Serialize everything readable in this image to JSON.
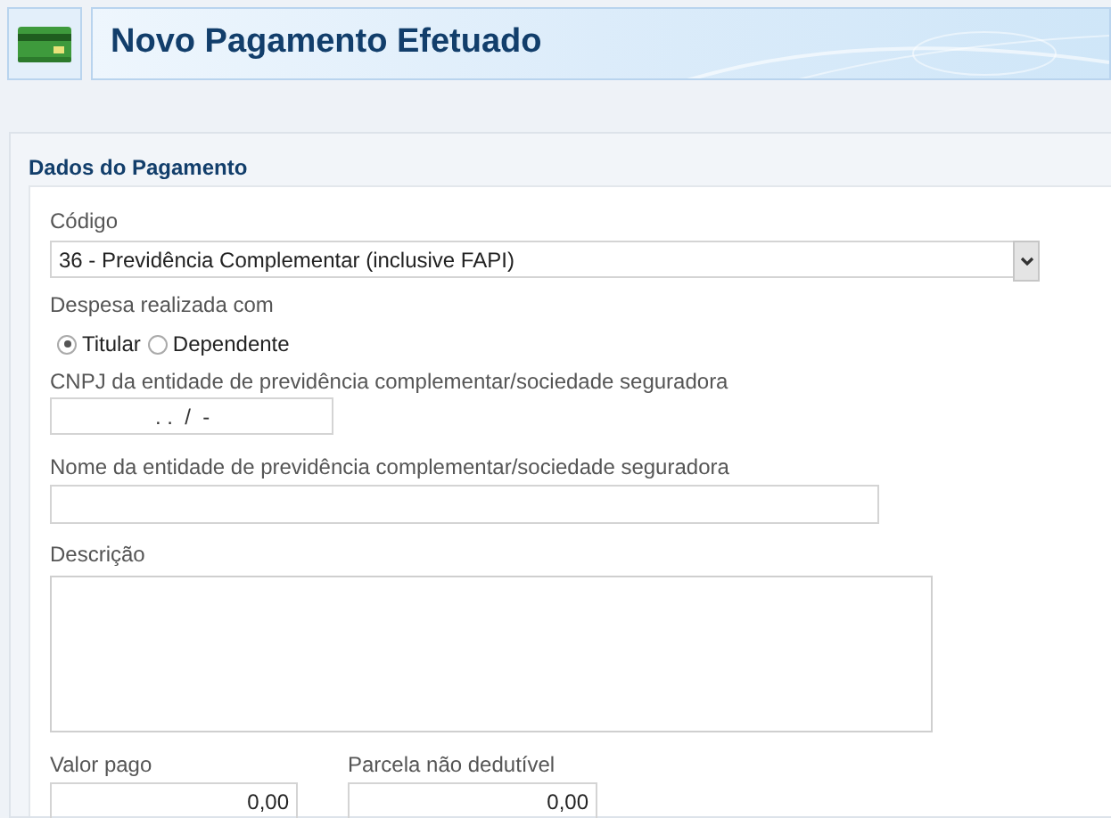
{
  "header": {
    "title": "Novo Pagamento Efetuado"
  },
  "section": {
    "title": "Dados do Pagamento"
  },
  "codigo": {
    "label": "Código",
    "value": "36 - Previdência Complementar (inclusive FAPI)"
  },
  "despesa": {
    "label": "Despesa realizada com",
    "options": [
      {
        "label": "Titular",
        "selected": true
      },
      {
        "label": "Dependente",
        "selected": false
      }
    ]
  },
  "cnpj": {
    "label": "CNPJ da entidade de previdência complementar/sociedade seguradora",
    "value": ". .  /  -"
  },
  "nome": {
    "label": "Nome da entidade de previdência complementar/sociedade seguradora"
  },
  "descricao": {
    "label": "Descrição"
  },
  "valor_pago": {
    "label": "Valor pago",
    "value": "0,00"
  },
  "parcela": {
    "label": "Parcela não dedutível",
    "value": "0,00"
  }
}
